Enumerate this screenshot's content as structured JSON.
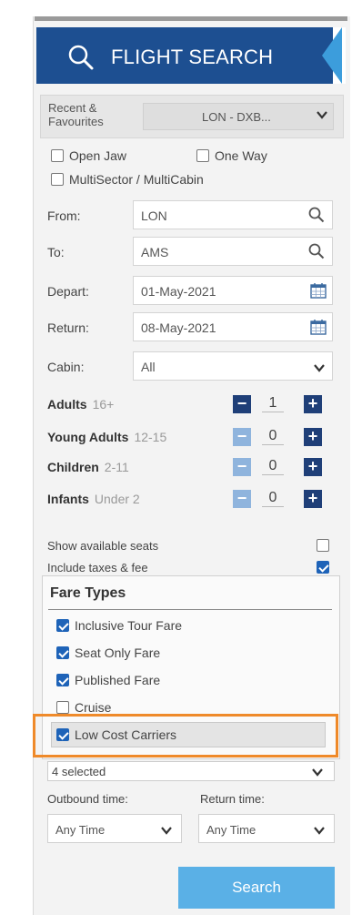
{
  "header": {
    "title": "FLIGHT SEARCH"
  },
  "recent": {
    "label_line1": "Recent &",
    "label_line2": "Favourites",
    "value": "LON - DXB..."
  },
  "trip_options": {
    "open_jaw": "Open Jaw",
    "one_way": "One Way",
    "multisector": "MultiSector / MultiCabin"
  },
  "fields": {
    "from": {
      "label": "From:",
      "value": "LON"
    },
    "to": {
      "label": "To:",
      "value": "AMS"
    },
    "depart": {
      "label": "Depart:",
      "value": "01-May-2021"
    },
    "return": {
      "label": "Return:",
      "value": "08-May-2021"
    },
    "cabin": {
      "label": "Cabin:",
      "value": "All"
    }
  },
  "passengers": [
    {
      "label": "Adults",
      "range": "16+",
      "count": "1"
    },
    {
      "label": "Young Adults",
      "range": "12-15",
      "count": "0"
    },
    {
      "label": "Children",
      "range": "2-11",
      "count": "0"
    },
    {
      "label": "Infants",
      "range": "Under 2",
      "count": "0"
    }
  ],
  "options": {
    "show_seats": "Show available seats",
    "include_taxes": "Include taxes & fee"
  },
  "fare_types": {
    "title": "Fare Types",
    "items": [
      {
        "label": "Inclusive Tour Fare",
        "checked": true
      },
      {
        "label": "Seat Only Fare",
        "checked": true
      },
      {
        "label": "Published Fare",
        "checked": true
      },
      {
        "label": "Cruise",
        "checked": false
      },
      {
        "label": "Low Cost Carriers",
        "checked": true
      }
    ],
    "selected_summary": "4 selected"
  },
  "times": {
    "outbound_label": "Outbound time:",
    "return_label": "Return time:",
    "outbound_value": "Any Time",
    "return_value": "Any Time"
  },
  "search_button": "Search",
  "colors": {
    "header_bg": "#1d4f91",
    "accent": "#3c9ddc",
    "highlight": "#ef8a2a",
    "button": "#5ab0e6"
  }
}
